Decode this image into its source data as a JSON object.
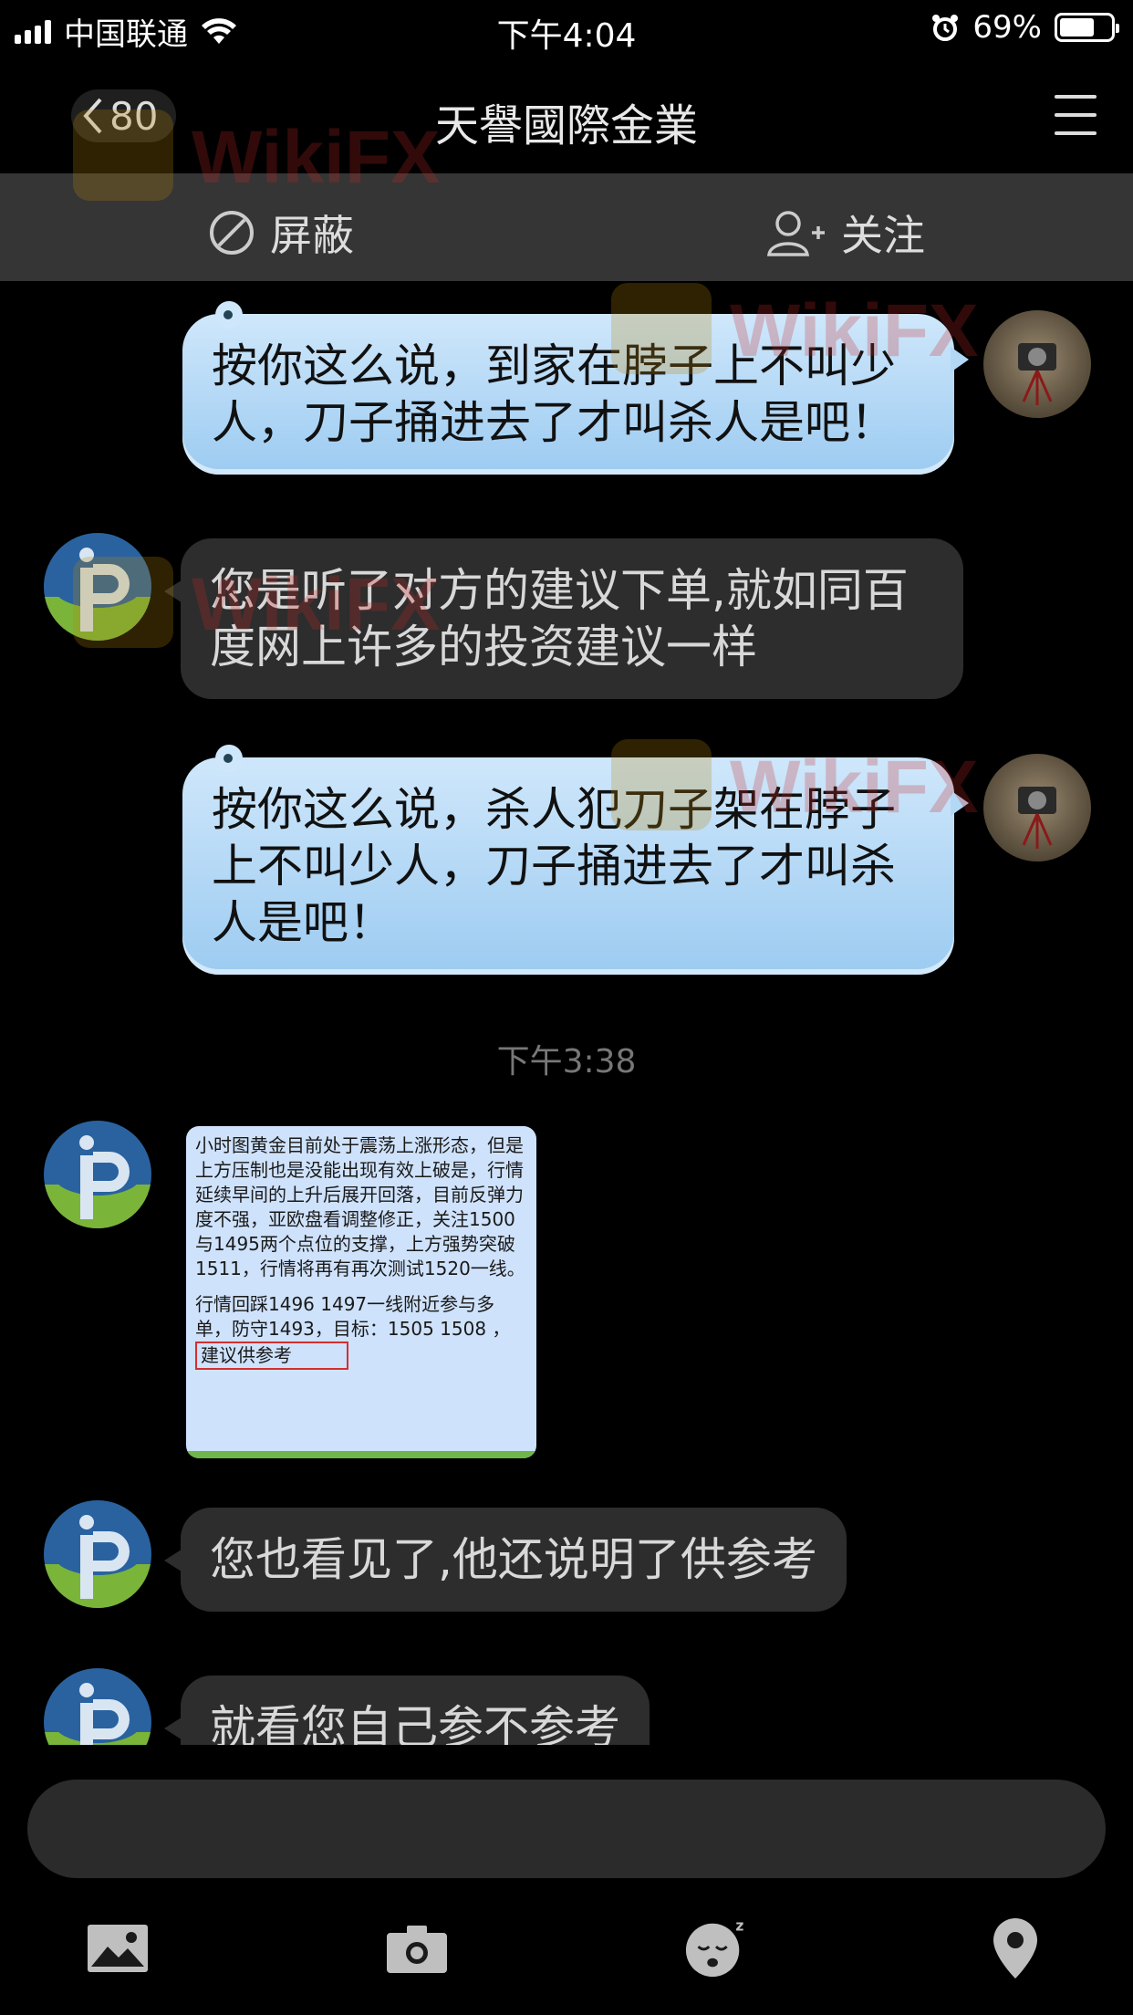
{
  "status_bar": {
    "carrier": "中国联通",
    "time": "下午4:04",
    "battery_percent": "69%",
    "battery_level": 0.69
  },
  "nav": {
    "back_count": "80",
    "title": "天譽國際金業"
  },
  "actions": {
    "block_label": "屏蔽",
    "follow_label": "关注"
  },
  "messages": [
    {
      "side": "out",
      "text": "按你这么说，到家在脖子上不叫少人，刀子捅进去了才叫杀人是吧！"
    },
    {
      "side": "in",
      "text": "您是听了对方的建议下单,就如同百度网上许多的投资建议一样"
    },
    {
      "side": "out",
      "text": "按你这么说，杀人犯刀子架在脖子上不叫少人，刀子捅进去了才叫杀人是吧！"
    },
    {
      "side": "in",
      "text": "您也看见了,他还说明了供参考"
    },
    {
      "side": "in",
      "text": "就看您自己参不参考"
    }
  ],
  "timestamp": "下午3:38",
  "image_message": {
    "para1": "小时图黄金目前处于震荡上涨形态，但是上方压制也是没能出现有效上破是，行情延续早间的上升后展开回落，目前反弹力度不强，亚欧盘看调整修正，关注1500与1495两个点位的支撑，上方强势突破1511，行情将再有再次测试1520一线。",
    "para2": "行情回踩1496 1497一线附近参与多单，防守1493，目标：1505 1508 ，",
    "highlight": "建议供参考"
  },
  "watermark": "WikiFX",
  "colors": {
    "out_bubble": "#a8d2f3",
    "in_bubble": "#2d2d2d",
    "action_bar": "#353535"
  },
  "toolbar_icons": [
    "photo-icon",
    "camera-icon",
    "emoji-icon",
    "location-icon"
  ]
}
